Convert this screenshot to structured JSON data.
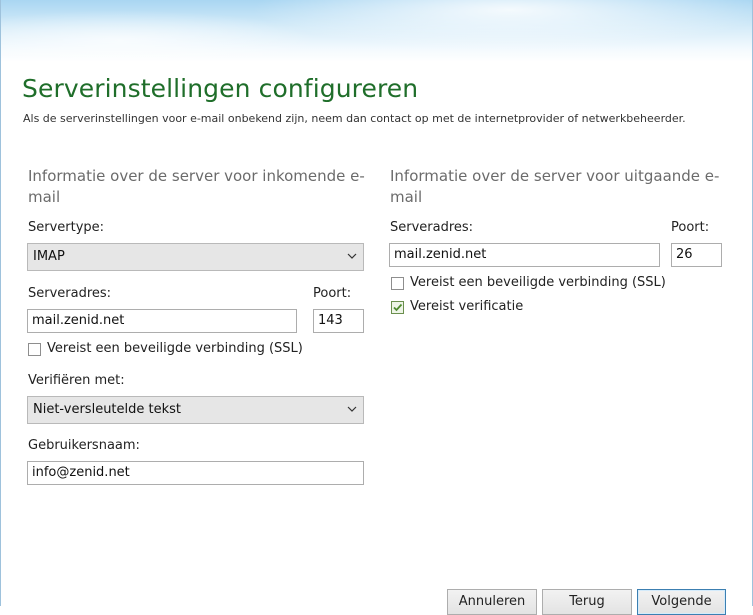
{
  "header": {
    "title": "Serverinstellingen configureren",
    "subtitle": "Als de serverinstellingen voor e-mail onbekend zijn, neem dan contact op met de internetprovider of netwerkbeheerder."
  },
  "incoming": {
    "section_title": "Informatie over de server voor inkomende e-mail",
    "server_type_label": "Servertype:",
    "server_type_value": "IMAP",
    "server_address_label": "Serveradres:",
    "server_address_value": "mail.zenid.net",
    "port_label": "Poort:",
    "port_value": "143",
    "ssl_label": "Vereist een beveiligde verbinding (SSL)",
    "ssl_checked": false,
    "auth_label": "Verifiëren met:",
    "auth_value": "Niet-versleutelde tekst",
    "username_label": "Gebruikersnaam:",
    "username_value": "info@zenid.net"
  },
  "outgoing": {
    "section_title": "Informatie over de server voor uitgaande e-mail",
    "server_address_label": "Serveradres:",
    "server_address_value": "mail.zenid.net",
    "port_label": "Poort:",
    "port_value": "26",
    "ssl_label": "Vereist een beveiligde verbinding (SSL)",
    "ssl_checked": false,
    "verify_label": "Vereist verificatie",
    "verify_checked": true
  },
  "buttons": {
    "cancel": "Annuleren",
    "back": "Terug",
    "next": "Volgende"
  },
  "colors": {
    "title_green": "#1f6e2a",
    "banner_blue": "#a9d6f2",
    "check_green": "#4e8a2f"
  }
}
